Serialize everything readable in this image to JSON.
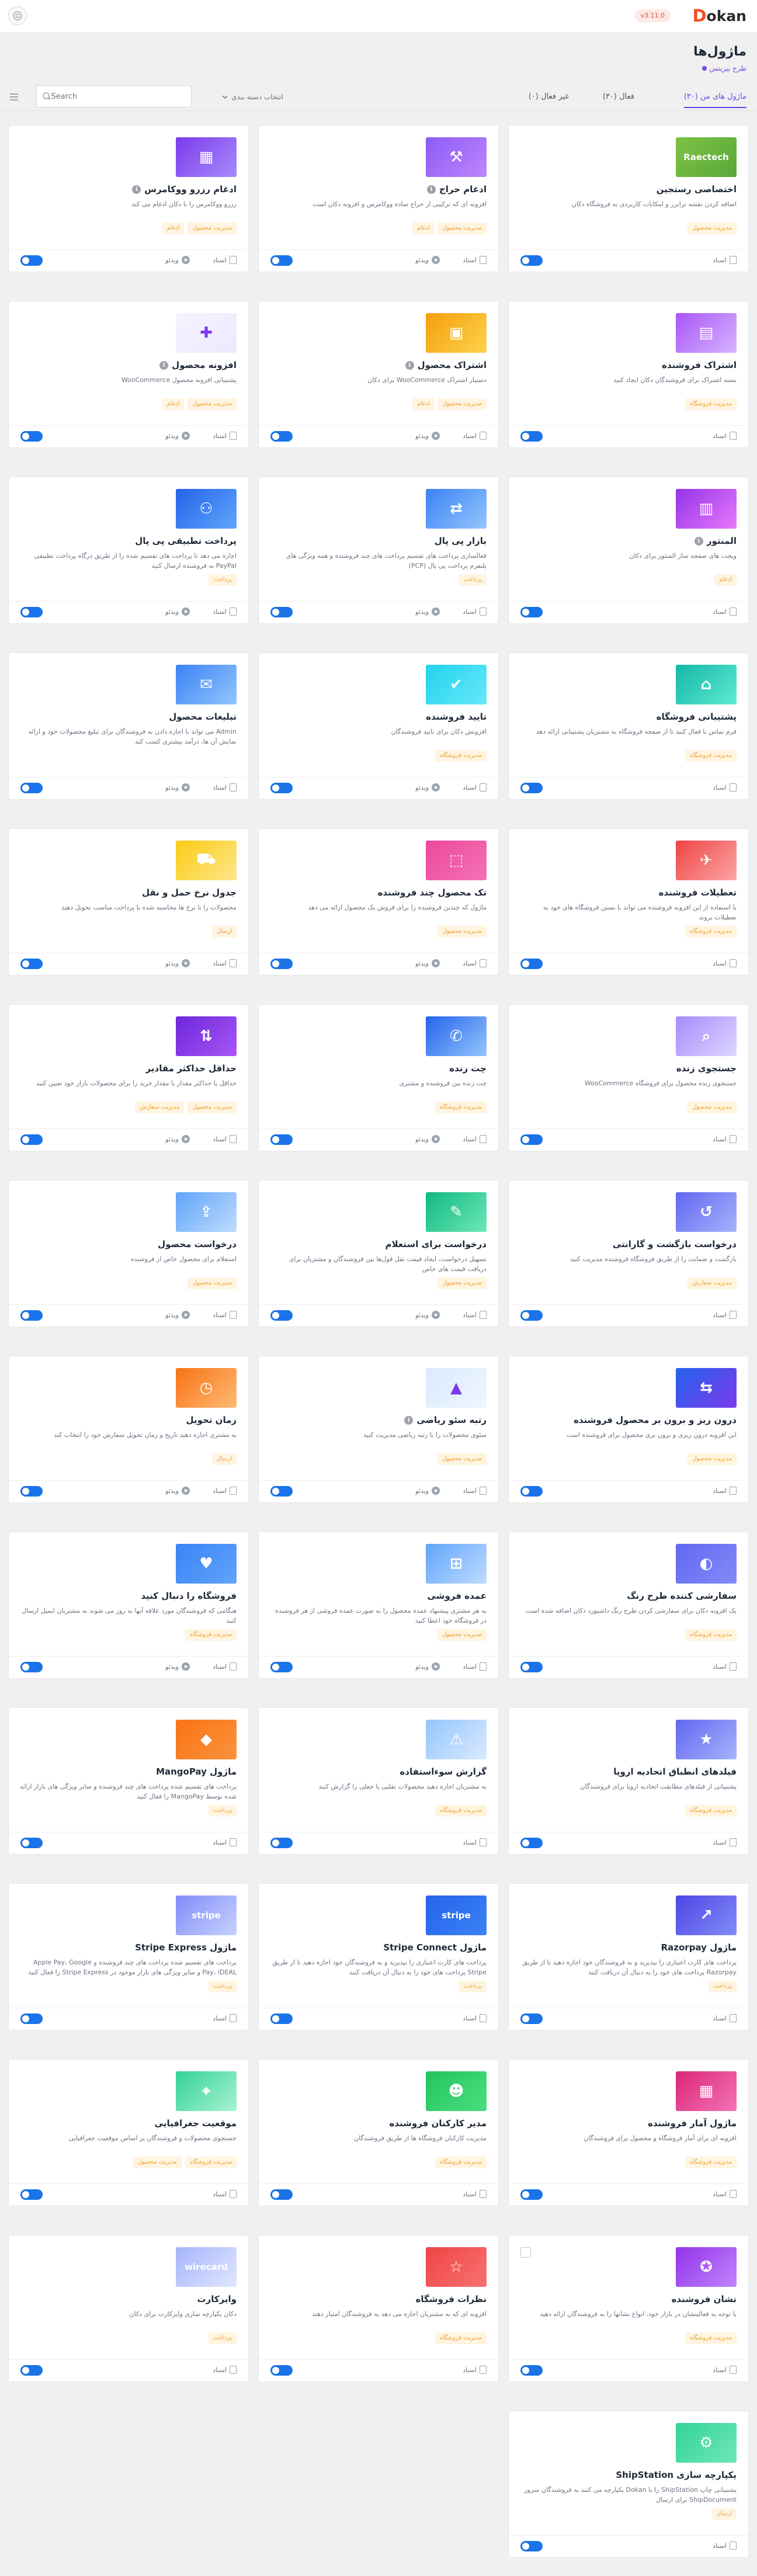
{
  "topbar": {
    "logo_mark": "D",
    "logo_text": "okan",
    "version": "v3.11.0"
  },
  "page": {
    "title": "ماژول‌ها",
    "subtitle": "طرح بیزینس"
  },
  "filters": {
    "tabs": [
      {
        "label": "ماژول های من (۳۰)"
      },
      {
        "label": "فعال (۳۰)"
      },
      {
        "label": "غیر فعال (۰)"
      }
    ],
    "category_label": "انتخاب دسته بندی",
    "search_placeholder": "Search..."
  },
  "labels": {
    "docs": "اسناد",
    "video": "ویدئو"
  },
  "modules": [
    {
      "title": "اختصاصی رستجین",
      "desc": "اضافه کردن نقشه ترابرز و امکانات کاربردی به فروشگاه دکان",
      "tags": [
        "مدیریت محصول"
      ],
      "info": false,
      "video": false,
      "thumb_text": "Raectech",
      "color": "#7dc244",
      "color2": "#5aa83a",
      "icon": "brand-icon"
    },
    {
      "title": "ادغام حراج",
      "desc": "افزونه ای که ترکیبی از حراج ساده ووکامرس و افزونه دکان است",
      "tags": [
        "مدیریت محصول",
        "ادغام"
      ],
      "info": true,
      "video": true,
      "color": "#8b5cf6",
      "color2": "#c084fc",
      "icon": "gavel-icon"
    },
    {
      "title": "ادغام رزرو ووکامرس",
      "desc": "رزرو ووکامرس را با دکان ادغام می کند",
      "tags": [
        "مدیریت محصول",
        "ادغام"
      ],
      "info": true,
      "video": true,
      "color": "#7c3aed",
      "color2": "#a78bfa",
      "icon": "calendar-icon"
    },
    {
      "title": "اشتراک فروشنده",
      "desc": "بسته اشتراک برای فروشندگان دکان ایجاد کنید",
      "tags": [
        "مدیریت فروشگاه"
      ],
      "info": false,
      "video": false,
      "color": "#a855f7",
      "color2": "#d8b4fe",
      "icon": "subscription-icon"
    },
    {
      "title": "اشتراک محصول",
      "desc": "دستیار اشتراک WooCommerce برای دکان",
      "tags": [
        "مدیریت محصول",
        "ادغام"
      ],
      "info": true,
      "video": true,
      "color": "#f59e0b",
      "color2": "#fcd34d",
      "icon": "box-icon"
    },
    {
      "title": "افزونه محصول",
      "desc": "پشتیبانی افزونه محصول WooCommerce",
      "tags": [
        "مدیریت محصول",
        "ادغام"
      ],
      "info": true,
      "video": true,
      "color": "#f5f3ff",
      "color2": "#ede9fe",
      "icon": "addon-icon"
    },
    {
      "title": "المنتور",
      "desc": "ویجت های صفحه ساز المنتور برای دکان",
      "tags": [
        "ادغام"
      ],
      "info": true,
      "video": false,
      "color": "#9333ea",
      "color2": "#e879f9",
      "icon": "elementor-icon"
    },
    {
      "title": "بازار پی پال",
      "desc": "فعالسازی پرداخت های تقسیم پرداخت های چند فروشنده و همه ویژگی های پلتفرم پرداخت پی پال (PCP)",
      "tags": [
        "پرداخت"
      ],
      "info": false,
      "video": true,
      "color": "#3b82f6",
      "color2": "#93c5fd",
      "icon": "paypal-icon"
    },
    {
      "title": "پرداخت تطبیقی پی پال",
      "desc": "اجازه می دهد تا پرداخت های تقسیم شده را از طریق درگاه پرداخت تطبیقی PayPal به فروشنده ارسال کنید",
      "tags": [
        "پرداخت"
      ],
      "info": false,
      "video": true,
      "color": "#2563eb",
      "color2": "#60a5fa",
      "icon": "network-icon"
    },
    {
      "title": "پشتیبانی فروشگاه",
      "desc": "فرم تماس با فعال کنید تا از صفحه فروشگاه به مشتریان پشتیبانی ارائه دهد",
      "tags": [
        "مدیریت فروشگاه"
      ],
      "info": false,
      "video": false,
      "color": "#14b8a6",
      "color2": "#5eead4",
      "icon": "store-icon"
    },
    {
      "title": "تایید فروشنده",
      "desc": "افزونش دکان برای تایید فروشندگان",
      "tags": [
        "مدیریت فروشگاه"
      ],
      "info": false,
      "video": true,
      "color": "#22d3ee",
      "color2": "#67e8f9",
      "icon": "verify-icon"
    },
    {
      "title": "تبلیغات محصول",
      "desc": "Admin می تواند با اجازه دادن به فروشندگان برای تبلیغ محصولات خود و ارائه نمایش آن ها، درآمد بیشتری کسب کند",
      "tags": [],
      "info": false,
      "video": true,
      "color": "#3b82f6",
      "color2": "#93c5fd",
      "icon": "megaphone-icon"
    },
    {
      "title": "تعطیلات فروشنده",
      "desc": "با استفاده از این افزونه فروشنده می تواند با بستن فروشگاه های خود به تعطیلات بروند",
      "tags": [
        "مدیریت فروشگاه"
      ],
      "info": false,
      "video": false,
      "color": "#ef4444",
      "color2": "#fca5a5",
      "icon": "vacation-icon"
    },
    {
      "title": "تک محصول چند فروشنده",
      "desc": "ماژول که چندین فروشنده را برای فروش یک محصول ارائه می دهد",
      "tags": [
        "مدیریت محصول"
      ],
      "info": false,
      "video": true,
      "color": "#ec4899",
      "color2": "#f472b6",
      "icon": "multi-vendor-icon"
    },
    {
      "title": "جدول نرخ حمل و نقل",
      "desc": "محصولات را با نرخ ها محاسبه شده با پرداخت مناسب تحویل دهید",
      "tags": [
        "ارسال"
      ],
      "info": false,
      "video": true,
      "color": "#facc15",
      "color2": "#fde68a",
      "icon": "truck-icon"
    },
    {
      "title": "جستجوی زنده",
      "desc": "جستجوی زنده محصول برای فروشگاه WooCommerce",
      "tags": [
        "مدیریت محصول"
      ],
      "info": false,
      "video": false,
      "color": "#a78bfa",
      "color2": "#ddd6fe",
      "icon": "search-live-icon"
    },
    {
      "title": "چت زنده",
      "desc": "چت زنده بین فروشنده و مشتری",
      "tags": [
        "مدیریت فروشگاه"
      ],
      "info": false,
      "video": true,
      "color": "#2563eb",
      "color2": "#93c5fd",
      "icon": "chat-icon"
    },
    {
      "title": "حداقل حداکثر مقادیر",
      "desc": "حداقل یا حداکثر مقدار یا مقدار خرید را برای محصولات بازار خود تعیین کنید",
      "tags": [
        "مدیریت محصول",
        "مدیریت سفارش"
      ],
      "info": false,
      "video": true,
      "color": "#6d28d9",
      "color2": "#a855f7",
      "icon": "minmax-icon"
    },
    {
      "title": "درخواست بازگشت و گارانتی",
      "desc": "بازگشت و ضمانت را از طریق فروشگاه فروشنده مدیریت کنید",
      "tags": [
        "مدیریت سفارش"
      ],
      "info": false,
      "video": false,
      "color": "#6366f1",
      "color2": "#a5b4fc",
      "icon": "return-icon"
    },
    {
      "title": "درخواست برای استعلام",
      "desc": "تسهیل درخواست، ایجاد قیمت نقل قول‌ها بین فروشندگان و مشتریان برای دریافت قیمت های خاص",
      "tags": [
        "مدیریت محصول"
      ],
      "info": false,
      "video": true,
      "color": "#10b981",
      "color2": "#6ee7b7",
      "icon": "quote-icon"
    },
    {
      "title": "درخواست محصول",
      "desc": "استعلام برای محصول خاص از فروشنده",
      "tags": [
        "مدیریت محصول"
      ],
      "info": false,
      "video": true,
      "color": "#60a5fa",
      "color2": "#bfdbfe",
      "icon": "request-icon"
    },
    {
      "title": "درون ریز و برون بر محصول فروشنده",
      "desc": "این افزونه درون ریزی و برون بری محصول برای فروشنده است",
      "tags": [
        "مدیریت محصول"
      ],
      "info": false,
      "video": false,
      "color": "#2563eb",
      "color2": "#7c3aed",
      "icon": "import-export-icon"
    },
    {
      "title": "رتبه سئو ریاضی",
      "desc": "سئوی محصولات را با رتبه ریاضی مدیریت کنید",
      "tags": [
        "مدیریت محصول"
      ],
      "info": true,
      "video": true,
      "color": "#dbeafe",
      "color2": "#eff6ff",
      "icon": "seo-icon"
    },
    {
      "title": "زمان تحویل",
      "desc": "به مشتری اجازه دهید تاریخ و زمان تحویل سفارش خود را انتخاب کند",
      "tags": [
        "ارسال"
      ],
      "info": false,
      "video": true,
      "color": "#f97316",
      "color2": "#fdba74",
      "icon": "clock-icon"
    },
    {
      "title": "سفارشی کننده طرح رنگ",
      "desc": "یک افزونه دکان برای سفارشی کردن طرح رنگ داشبورد دکان اضافه شده است",
      "tags": [
        "مدیریت فروشگاه"
      ],
      "info": false,
      "video": false,
      "color": "#6366f1",
      "color2": "#818cf8",
      "icon": "palette-icon"
    },
    {
      "title": "عمده فروشی",
      "desc": "به هر مشتری پیشنهاد عمده محصول را به صورت عمده فروشی از هر فروشنده در فروشگاه خود اعطا کنید",
      "tags": [
        "مدیریت محصول"
      ],
      "info": false,
      "video": true,
      "color": "#60a5fa",
      "color2": "#bfdbfe",
      "icon": "wholesale-icon"
    },
    {
      "title": "فروشگاه را دنبال کنید",
      "desc": "هنگامی که فروشندگان مورد علاقه آنها به روز می شوند به مشتریان ایمیل ارسال کنید",
      "tags": [
        "مدیریت فروشگاه"
      ],
      "info": false,
      "video": true,
      "color": "#3b82f6",
      "color2": "#60a5fa",
      "icon": "follow-icon"
    },
    {
      "title": "فیلدهای انطباق اتحادیه اروپا",
      "desc": "پشتیبانی از فیلدهای مطابقت اتحادیه اروپا برای فروشندگان",
      "tags": [
        "مدیریت فروشگاه"
      ],
      "info": false,
      "video": false,
      "color": "#6366f1",
      "color2": "#a5b4fc",
      "icon": "eu-icon"
    },
    {
      "title": "گزارش سوءاستفاده",
      "desc": "به مشتریان اجازه دهید محصولات تقلبی یا جعلی را گزارش کنند",
      "tags": [
        "مدیریت فروشگاه"
      ],
      "info": false,
      "video": false,
      "color": "#93c5fd",
      "color2": "#dbeafe",
      "icon": "report-icon"
    },
    {
      "title": "ماژول MangoPay",
      "desc": "پرداخت های تقسیم شده پرداخت های چند فروشنده و سایر ویژگی های بازار ارائه شده توسط MangoPay را فعال کنید",
      "tags": [
        "پرداخت"
      ],
      "info": false,
      "video": false,
      "color": "#f97316",
      "color2": "#fb923c",
      "icon": "mangopay-icon"
    },
    {
      "title": "ماژول Razorpay",
      "desc": "پرداخت های کارت اعتباری را بپذیرید و به فروشندگان خود اجازه دهید تا از طریق Razorpay پرداخت های خود را به دنبال آن دریافت کنند",
      "tags": [
        "پرداخت"
      ],
      "info": false,
      "video": false,
      "color": "#4f46e5",
      "color2": "#818cf8",
      "icon": "razorpay-icon"
    },
    {
      "title": "ماژول Stripe Connect",
      "desc": "پرداخت های کارت اعتباری را بپذیرید و به فروشندگان خود اجازه دهید تا از طریق Stripe پرداخت های خود را به دنبال آن دریافت کنند",
      "tags": [
        "پرداخت"
      ],
      "info": false,
      "video": false,
      "thumb_text": "stripe",
      "color": "#2563eb",
      "color2": "#3b82f6",
      "icon": "stripe-icon"
    },
    {
      "title": "ماژول Stripe Express",
      "desc": "پرداخت های تقسیم شده پرداخت های چند فروشنده و Apple Pay، Google Pay، iDEAL و سایر ویژگی های بازار موجود در Stripe Express را فعال کنید",
      "tags": [
        "پرداخت"
      ],
      "info": false,
      "video": false,
      "thumb_text": "stripe",
      "color": "#818cf8",
      "color2": "#c7d2fe",
      "icon": "stripe-express-icon"
    },
    {
      "title": "ماژول آمار فروشنده",
      "desc": "افزونه ای برای آمار فروشگاه و محصول برای فروشندگان",
      "tags": [
        "مدیریت فروشگاه"
      ],
      "info": false,
      "video": false,
      "color": "#db2777",
      "color2": "#f472b6",
      "icon": "stats-icon"
    },
    {
      "title": "مدیر کارکنان فروشنده",
      "desc": "مدیریت کارکنان فروشگاه ها از طریق فروشندگان",
      "tags": [
        "مدیریت فروشگاه"
      ],
      "info": false,
      "video": false,
      "color": "#22c55e",
      "color2": "#4ade80",
      "icon": "staff-icon"
    },
    {
      "title": "موقعیت جغرافیایی",
      "desc": "جستجوی محصولات و فروشندگان بر اساس موقعیت جغرافیایی",
      "tags": [
        "مدیریت فروشگاه",
        "مدیریت محصول"
      ],
      "info": false,
      "video": false,
      "color": "#34d399",
      "color2": "#a7f3d0",
      "icon": "location-icon"
    },
    {
      "title": "نشان فروشنده",
      "desc": "با توجه به فعالیتشان در بازار خود، انواع نشانها را به فروشندگان ارائه دهید",
      "tags": [
        "مدیریت فروشگاه"
      ],
      "info": false,
      "video": false,
      "checkbox": true,
      "color": "#9333ea",
      "color2": "#c084fc",
      "icon": "badge-icon"
    },
    {
      "title": "نظرات فروشگاه",
      "desc": "افزونه ای که به مشتریان اجازه می دهد به فروشندگان امتیاز دهند",
      "tags": [
        "مدیریت فروشگاه"
      ],
      "info": false,
      "video": false,
      "color": "#ef4444",
      "color2": "#f87171",
      "icon": "reviews-icon"
    },
    {
      "title": "وایرکارت",
      "desc": "دکان یکپارچه سازی وایرکارت برای دکان",
      "tags": [
        "پرداخت"
      ],
      "info": false,
      "video": false,
      "thumb_text": "wirecard",
      "color": "#a5b4fc",
      "color2": "#e0e7ff",
      "icon": "wirecard-icon"
    },
    {
      "title": "یکپارچه سازی ShipStation",
      "desc": "پشتیبانی چاپ ShipStation را با Dokan یکپارچه می کنند به فروشندگان سرور ShipDocument برای ارسال",
      "tags": [
        "ارسال"
      ],
      "info": false,
      "video": false,
      "color": "#34d399",
      "color2": "#6ee7b7",
      "icon": "shipstation-icon"
    }
  ]
}
